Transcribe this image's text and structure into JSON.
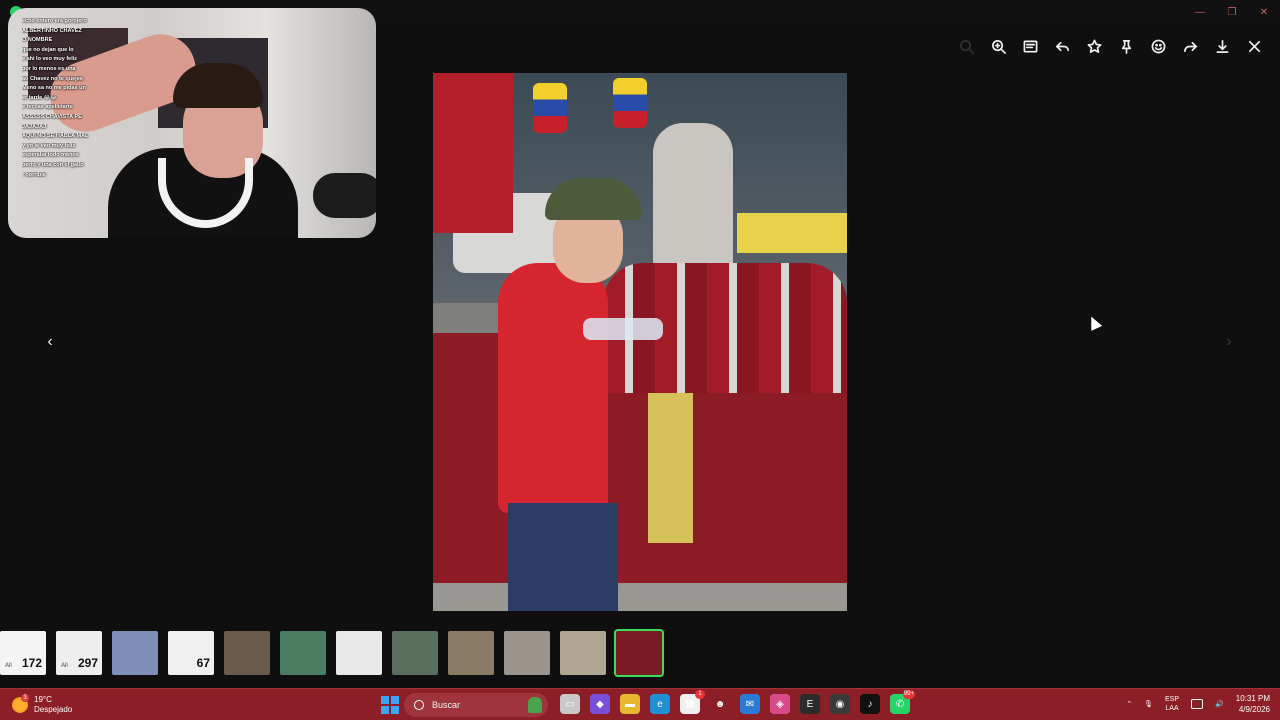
{
  "window": {
    "minimize": "—",
    "restore": "❐",
    "close": "✕"
  },
  "toolbar": {
    "icons": [
      "search-icon",
      "zoom-in-icon",
      "caption-icon",
      "reply-icon",
      "star-icon",
      "pin-icon",
      "emoji-icon",
      "forward-icon",
      "download-icon",
      "close-icon"
    ]
  },
  "stream_chat": [
    "echo entero era gorojero",
    "ALBERTINHO CHAVEZ",
    "O NOMBRE",
    "que no dejan que lo",
    "e ahi lo veo muy feliz",
    "por lo menos es una",
    "ao Chavez no te quejes",
    "Meno sa no me pidas un",
    "er tarde 😂😂",
    "e fecilas apellidarte",
    "ASSSSS CHAVISTA PE",
    "JAJAJAJ",
    "AQUI NO SE HABLA MAL",
    "y yo le veo muy feliz",
    "esperaba todo menos",
    "berto y una con el gallo",
    "- horrible"
  ],
  "navigation": {
    "prev": "‹",
    "next": "›"
  },
  "thumbnails": [
    {
      "label": "All",
      "number": "172",
      "bg": "#f4f4f4"
    },
    {
      "label": "All",
      "number": "297",
      "bg": "#eeeeee"
    },
    {
      "label": "",
      "number": "",
      "bg": "#7d8fb8"
    },
    {
      "label": "",
      "number": "67",
      "bg": "#f0f0f0"
    },
    {
      "label": "",
      "number": "",
      "bg": "#6a5a4a"
    },
    {
      "label": "",
      "number": "",
      "bg": "#4c7d62"
    },
    {
      "label": "",
      "number": "",
      "bg": "#e8e8e8"
    },
    {
      "label": "",
      "number": "",
      "bg": "#5a6e5e"
    },
    {
      "label": "",
      "number": "",
      "bg": "#8a7a66"
    },
    {
      "label": "",
      "number": "",
      "bg": "#9a948c"
    },
    {
      "label": "",
      "number": "",
      "bg": "#b0a590"
    },
    {
      "label": "",
      "number": "",
      "bg": "#7a1a22",
      "active": true
    }
  ],
  "taskbar": {
    "weather_temp": "19°C",
    "weather_desc": "Despejado",
    "weather_badge": "3",
    "search_placeholder": "Buscar",
    "apps": [
      {
        "name": "task-view-icon",
        "bg": "#c8c8c8",
        "glyph": "▭",
        "badge": ""
      },
      {
        "name": "copilot-icon",
        "bg": "#7a4fd8",
        "glyph": "◆",
        "badge": ""
      },
      {
        "name": "file-explorer-icon",
        "bg": "#e8b730",
        "glyph": "▬",
        "badge": ""
      },
      {
        "name": "edge-icon",
        "bg": "#1f8fd8",
        "glyph": "e",
        "badge": ""
      },
      {
        "name": "store-icon",
        "bg": "#f0f0f0",
        "glyph": "▦",
        "badge": "1"
      },
      {
        "name": "alien-icon",
        "bg": "#8b1e26",
        "glyph": "☻",
        "badge": ""
      },
      {
        "name": "mail-icon",
        "bg": "#2a7bd6",
        "glyph": "✉",
        "badge": ""
      },
      {
        "name": "m365-icon",
        "bg": "#d94a8a",
        "glyph": "◈",
        "badge": ""
      },
      {
        "name": "epic-icon",
        "bg": "#2b2b2b",
        "glyph": "E",
        "badge": ""
      },
      {
        "name": "obs-icon",
        "bg": "#3a3a3a",
        "glyph": "◉",
        "badge": ""
      },
      {
        "name": "tiktok-icon",
        "bg": "#111111",
        "glyph": "♪",
        "badge": ""
      },
      {
        "name": "whatsapp-icon",
        "bg": "#25d366",
        "glyph": "✆",
        "badge": "99+"
      }
    ],
    "lang_top": "ESP",
    "lang_bottom": "LAA",
    "time": "10:31 PM",
    "date": "4/9/2026"
  }
}
